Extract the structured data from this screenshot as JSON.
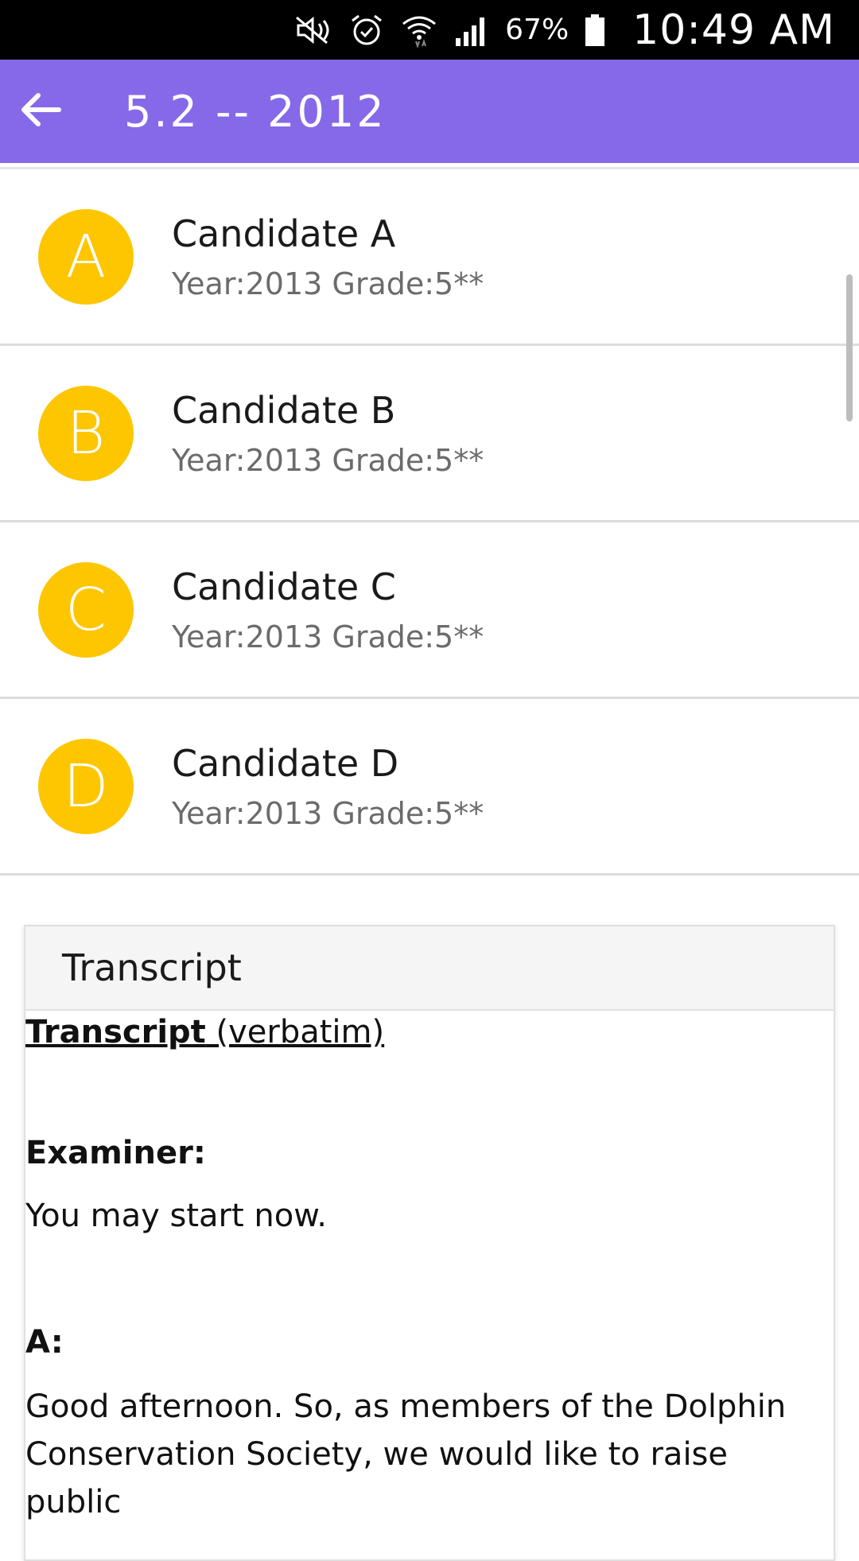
{
  "status_bar": {
    "battery": "67%",
    "time": "10:49 AM",
    "icons": [
      "mute-icon",
      "alarm-icon",
      "wifi-icon",
      "signal-icon",
      "battery-icon"
    ]
  },
  "app_bar": {
    "title": "5.2 -- 2012",
    "back_icon": "arrow-left-icon",
    "background": "#8669e8"
  },
  "candidates": [
    {
      "initial": "A",
      "name": "Candidate A",
      "meta": "Year:2013 Grade:5**"
    },
    {
      "initial": "B",
      "name": "Candidate B",
      "meta": "Year:2013 Grade:5**"
    },
    {
      "initial": "C",
      "name": "Candidate C",
      "meta": "Year:2013 Grade:5**"
    },
    {
      "initial": "D",
      "name": "Candidate D",
      "meta": "Year:2013 Grade:5**"
    }
  ],
  "avatar_color": "#fec600",
  "transcript": {
    "card_title": "Transcript",
    "heading_bold": "Transcript",
    "heading_rest": " (verbatim)",
    "examiner_label": "Examiner:",
    "examiner_text": "You may start now.",
    "a_label": "A:",
    "a_text_line1": "Good afternoon. So, as members of the Dolphin",
    "a_text_line2": "Conservation Society, we would like to raise public"
  }
}
